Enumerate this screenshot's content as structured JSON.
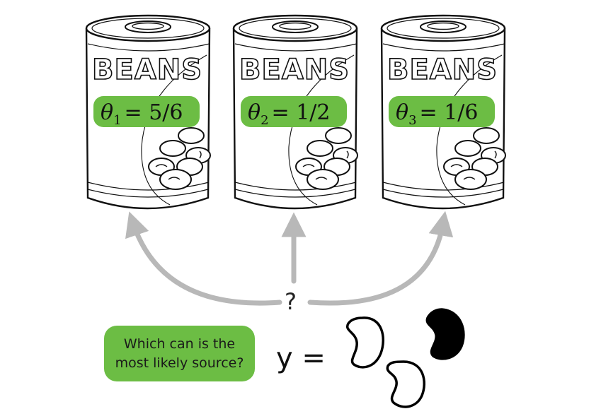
{
  "cans": [
    {
      "title": "BEANS",
      "theta_symbol": "θ",
      "theta_index": "1",
      "theta_value": "= 5/6"
    },
    {
      "title": "BEANS",
      "theta_symbol": "θ",
      "theta_index": "2",
      "theta_value": "= 1/2"
    },
    {
      "title": "BEANS",
      "theta_symbol": "θ",
      "theta_index": "3",
      "theta_value": "= 1/6"
    }
  ],
  "question_mark": "?",
  "question": "Which can is the most likely source?",
  "observation": {
    "label": "y =",
    "beans": [
      "white",
      "white",
      "black"
    ]
  },
  "colors": {
    "label_green": "#6cbd44",
    "arrow_gray": "#b8b8b8",
    "outline": "#111111"
  }
}
